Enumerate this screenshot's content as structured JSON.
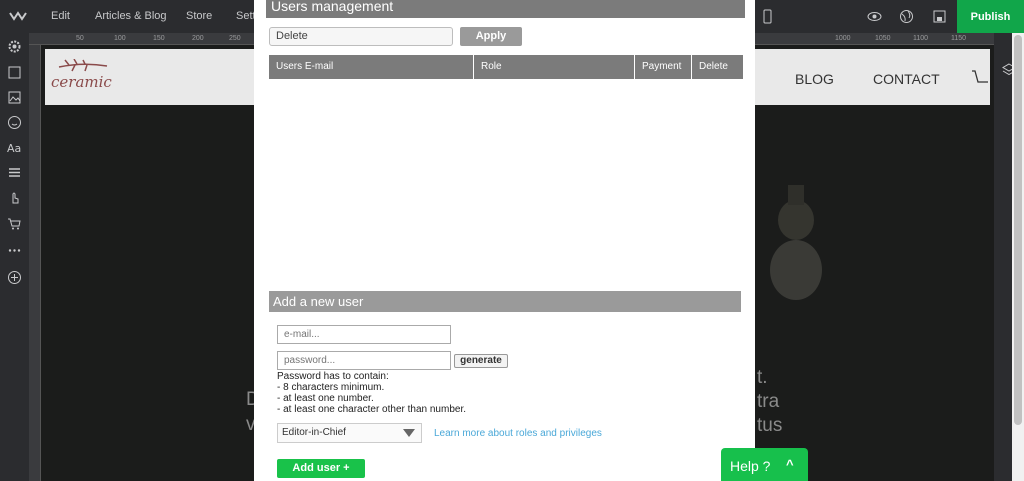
{
  "topbar": {
    "nav": [
      "Edit",
      "Articles & Blog",
      "Store",
      "Sett"
    ],
    "publish": "Publish"
  },
  "ruler": {
    "top_ticks": [
      "50",
      "100",
      "150",
      "200",
      "250",
      "1000",
      "1050",
      "1100",
      "1150"
    ]
  },
  "site": {
    "logo": "ceramic",
    "nav": [
      "BLOG",
      "CONTACT"
    ],
    "hero_lines_left": [
      "D",
      "v"
    ],
    "hero_lines_right": [
      "t.",
      "tra",
      "tus"
    ]
  },
  "users_panel": {
    "title": "Users management",
    "bulk_action": "Delete",
    "apply": "Apply",
    "columns": [
      "Users E-mail",
      "Role",
      "Payment",
      "Delete"
    ],
    "add_section_title": "Add a new user",
    "email_placeholder": "e-mail...",
    "password_placeholder": "password...",
    "generate": "generate",
    "rules": [
      "Password has to contain:",
      "- 8 characters minimum.",
      "- at least one number.",
      "- at least one character other than number."
    ],
    "role_value": "Editor-in-Chief",
    "learn_more": "Learn more about roles and privileges",
    "add_user": "Add user +"
  },
  "help": {
    "label": "Help ?",
    "chevron": "^"
  },
  "colors": {
    "publish": "#11a64a",
    "add_user": "#19c24a",
    "link": "#4aa8d8"
  }
}
